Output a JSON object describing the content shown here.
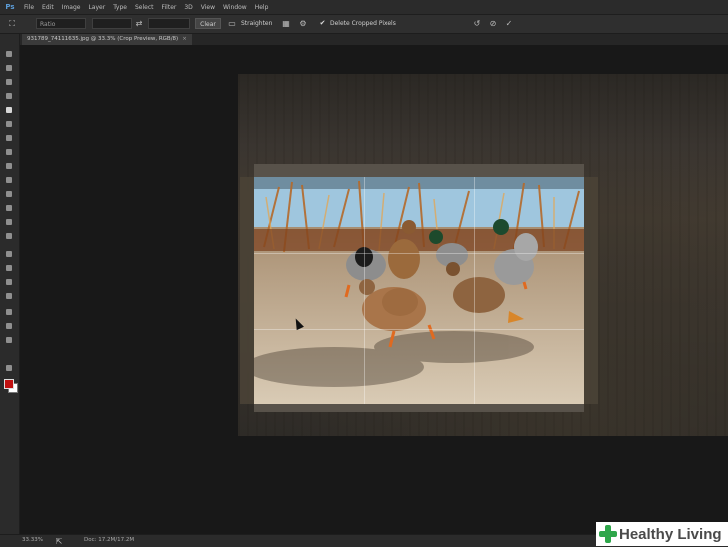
{
  "app": {
    "logo": "Ps"
  },
  "menu": [
    "File",
    "Edit",
    "Image",
    "Layer",
    "Type",
    "Select",
    "Filter",
    "3D",
    "View",
    "Window",
    "Help"
  ],
  "options": {
    "ratio_label": "Ratio",
    "clear_label": "Clear",
    "straighten_label": "Straighten",
    "delete_cropped_label": "Delete Cropped Pixels",
    "delete_cropped_checked": true
  },
  "document": {
    "tab_title": "931789_74111635.jpg @ 33.3% (Crop Preview, RGB/8)"
  },
  "colors": {
    "foreground": "#c01010",
    "background": "#ffffff"
  },
  "status": {
    "zoom": "33.33%",
    "doc": "Doc: 17.2M/17.2M"
  },
  "brand": {
    "text": "Healthy Living"
  },
  "icons": {
    "crop_tool": "crop-icon",
    "swap": "swap-icon",
    "settings": "gear-icon",
    "reset": "reset-icon",
    "cancel": "cancel-icon",
    "commit": "checkmark-icon"
  }
}
